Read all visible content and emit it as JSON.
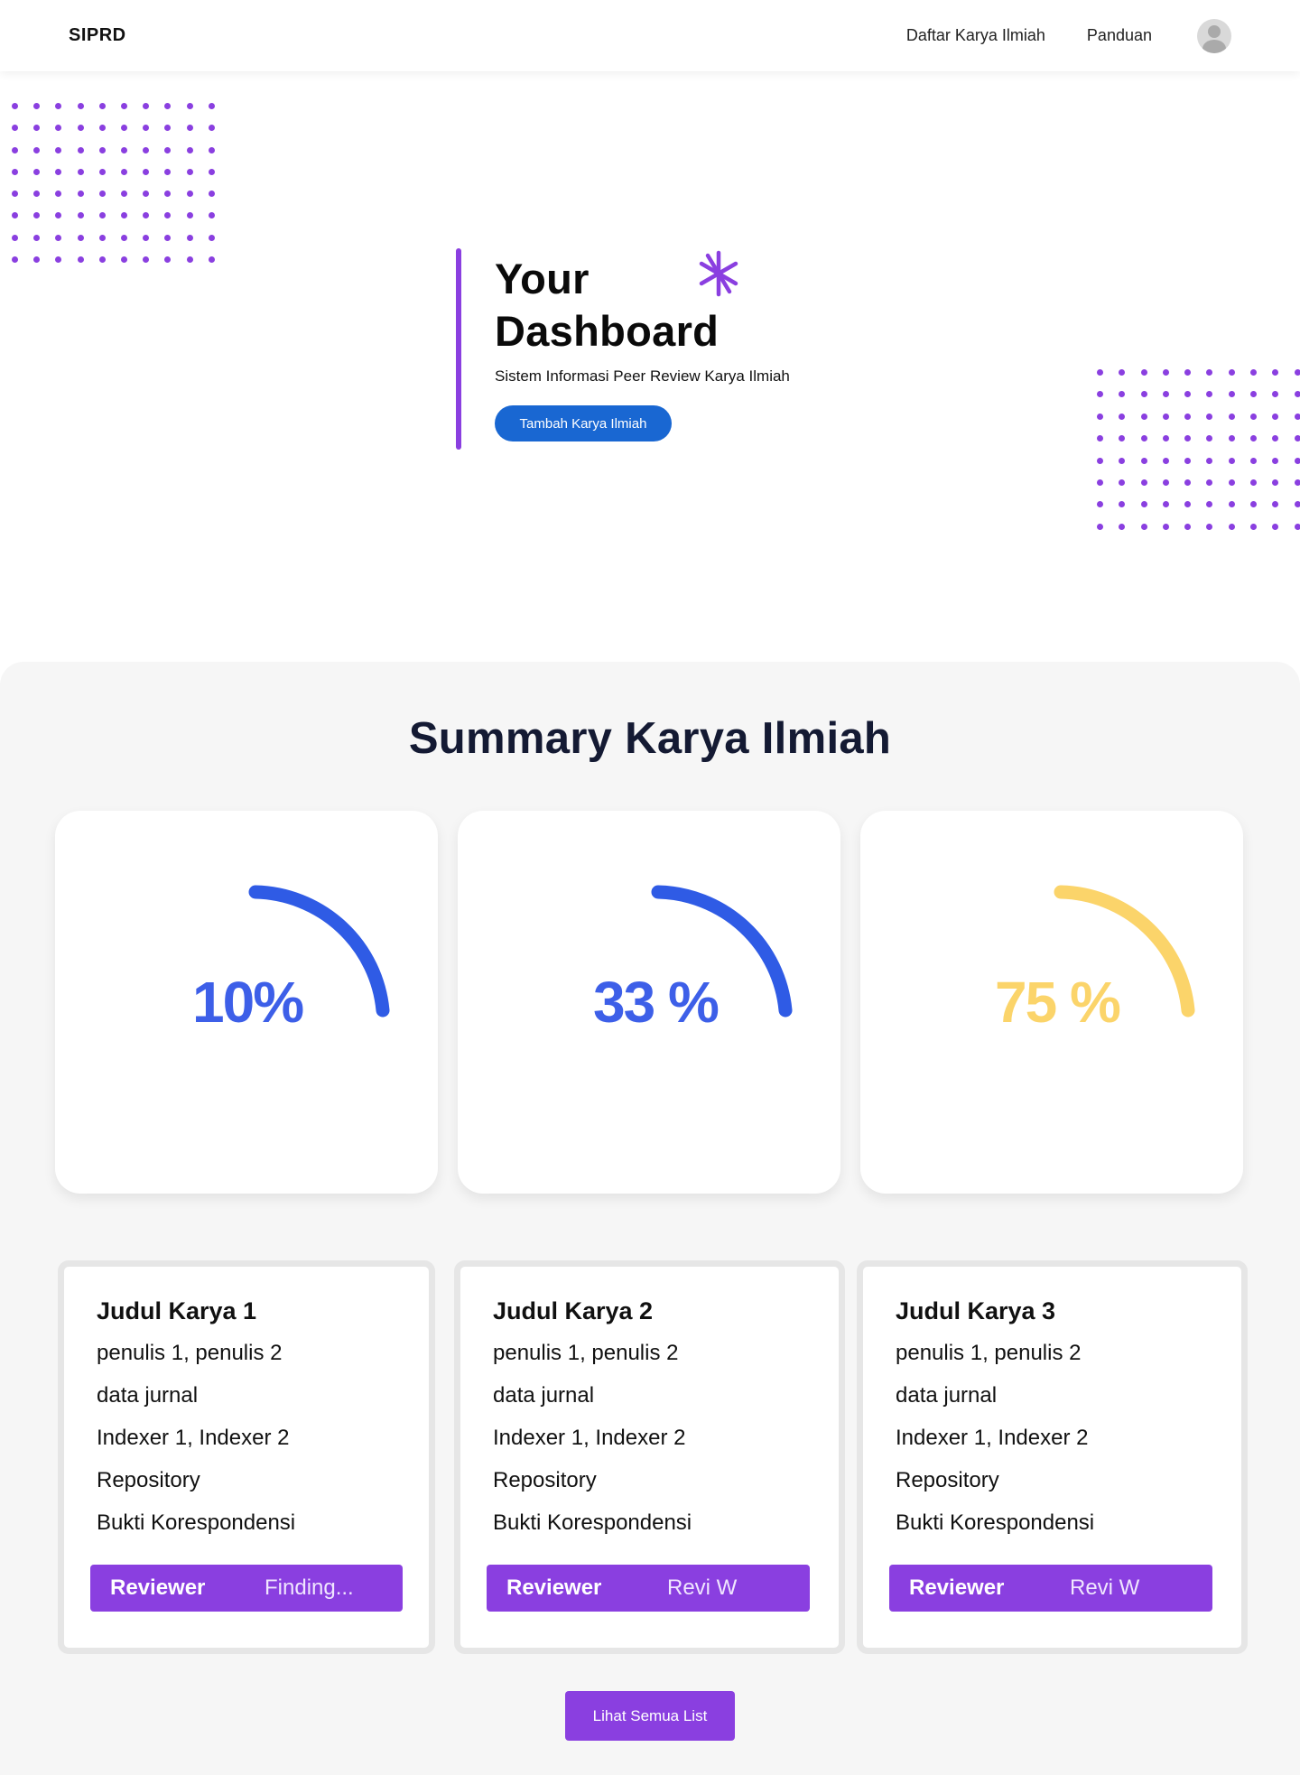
{
  "navbar": {
    "brand": "SIPRD",
    "links": [
      "Daftar Karya Ilmiah",
      "Panduan"
    ]
  },
  "hero": {
    "title_line1": "Your",
    "title_line2": "Dashboard",
    "subtitle": "Sistem Informasi Peer Review Karya Ilmiah",
    "cta_label": "Tambah Karya Ilmiah"
  },
  "summary": {
    "title": "Summary Karya Ilmiah",
    "stats": [
      {
        "label": "10%",
        "value": 10,
        "color": "#3d5fe8"
      },
      {
        "label": "33 %",
        "value": 33,
        "color": "#3d5fe8"
      },
      {
        "label": "75 %",
        "value": 75,
        "color": "#fbd46a"
      }
    ],
    "works": [
      {
        "title": "Judul Karya 1",
        "authors": "penulis 1, penulis 2",
        "journal": "data jurnal",
        "indexers": "Indexer 1, Indexer 2",
        "repository": "Repository",
        "evidence": "Bukti Korespondensi",
        "reviewer_label": "Reviewer",
        "reviewer_value": "Finding..."
      },
      {
        "title": "Judul Karya 2",
        "authors": "penulis 1, penulis 2",
        "journal": "data jurnal",
        "indexers": "Indexer 1, Indexer 2",
        "repository": "Repository",
        "evidence": "Bukti Korespondensi",
        "reviewer_label": "Reviewer",
        "reviewer_value": "Revi W"
      },
      {
        "title": "Judul Karya 3",
        "authors": "penulis 1, penulis 2",
        "journal": "data jurnal",
        "indexers": "Indexer 1, Indexer 2",
        "repository": "Repository",
        "evidence": "Bukti Korespondensi",
        "reviewer_label": "Reviewer",
        "reviewer_value": "Revi W"
      }
    ],
    "list_button": "Lihat Semua List"
  },
  "icons": {
    "avatar": "user-avatar-icon",
    "star": "asterisk-icon",
    "pattern": "dot-pattern"
  },
  "colors": {
    "accent": "#8a3fe0",
    "primary_button": "#1967d2",
    "gauge_blue": "#3d5fe8",
    "gauge_yellow": "#fbd46a",
    "section_bg": "#f6f6f6"
  }
}
